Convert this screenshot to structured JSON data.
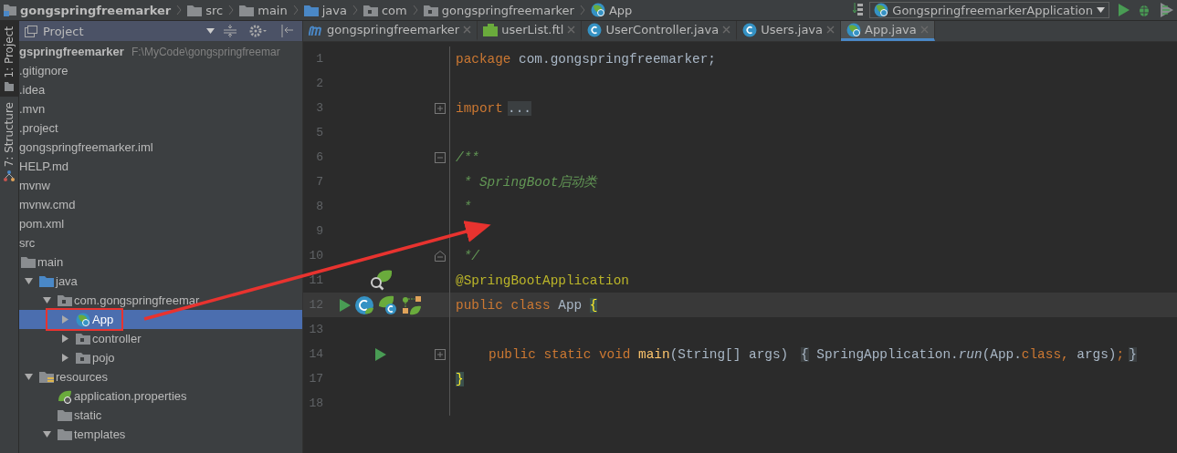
{
  "breadcrumbs": [
    {
      "label": "gongspringfreemarker",
      "kind": "project"
    },
    {
      "label": "src",
      "kind": "folder"
    },
    {
      "label": "main",
      "kind": "folder"
    },
    {
      "label": "java",
      "kind": "source"
    },
    {
      "label": "com",
      "kind": "package"
    },
    {
      "label": "gongspringfreemarker",
      "kind": "package"
    },
    {
      "label": "App",
      "kind": "app"
    }
  ],
  "run_config": {
    "label": "GongspringfreemarkerApplication"
  },
  "side_tabs": [
    {
      "label": "1: Project",
      "selected": true
    },
    {
      "label": "7: Structure",
      "selected": false
    }
  ],
  "project_panel": {
    "title": "Project",
    "tree": [
      {
        "label": "gspringfreemarker",
        "path": "F:\\MyCode\\gongspringfreemar",
        "selected": false,
        "children": [
          {
            "label": ".gitignore",
            "selected": false
          },
          {
            "label": ".idea",
            "selected": false
          },
          {
            "label": ".mvn",
            "selected": false
          },
          {
            "label": ".project",
            "selected": false
          },
          {
            "label": "gongspringfreemarker.iml",
            "selected": false
          },
          {
            "label": "HELP.md",
            "selected": false
          },
          {
            "label": "mvnw",
            "selected": false
          },
          {
            "label": "mvnw.cmd",
            "selected": false
          },
          {
            "label": "pom.xml",
            "selected": false
          },
          {
            "label": "src",
            "selected": false,
            "children": [
              {
                "label": "main",
                "kind": "folder",
                "selected": false,
                "children": [
                  {
                    "label": "java",
                    "kind": "source",
                    "expanded": true,
                    "selected": false,
                    "children": [
                      {
                        "label": "com.gongspringfreemar",
                        "kind": "package",
                        "expanded": true,
                        "selected": false,
                        "children": [
                          {
                            "label": "App",
                            "kind": "app",
                            "expanded": false,
                            "selected": true
                          },
                          {
                            "label": "controller",
                            "kind": "package",
                            "expanded": false,
                            "selected": false
                          },
                          {
                            "label": "pojo",
                            "kind": "package",
                            "expanded": false,
                            "selected": false
                          }
                        ]
                      }
                    ]
                  },
                  {
                    "label": "resources",
                    "kind": "resources",
                    "expanded": true,
                    "selected": false,
                    "children": [
                      {
                        "label": "application.properties",
                        "kind": "properties",
                        "selected": false
                      },
                      {
                        "label": "static",
                        "kind": "folder",
                        "selected": false
                      },
                      {
                        "label": "templates",
                        "kind": "folder",
                        "expanded": true,
                        "selected": false
                      }
                    ]
                  }
                ]
              }
            ]
          }
        ]
      }
    ]
  },
  "editor_tabs": [
    {
      "label": "gongspringfreemarker",
      "kind": "maven",
      "selected": false
    },
    {
      "label": "userList.ftl",
      "kind": "ftl",
      "selected": false
    },
    {
      "label": "UserController.java",
      "kind": "class",
      "selected": false
    },
    {
      "label": "Users.java",
      "kind": "class",
      "selected": false
    },
    {
      "label": "App.java",
      "kind": "app",
      "selected": true
    }
  ],
  "code_lines": [
    {
      "number": "1",
      "tokens": [
        {
          "kind": "keyword",
          "text": "package"
        },
        {
          "kind": "plain",
          "text": " com.gongspringfreemarker;"
        }
      ]
    },
    {
      "number": "2"
    },
    {
      "number": "3",
      "fold_marker": {
        "kind": "plus"
      },
      "tokens": [
        {
          "kind": "keyword",
          "text": "import"
        },
        {
          "kind": "folded",
          "text": "..."
        }
      ]
    },
    {
      "number": "5"
    },
    {
      "number": "6",
      "fold_marker": {
        "kind": "minus"
      },
      "tokens": [
        {
          "kind": "doc",
          "text": "/**"
        }
      ]
    },
    {
      "number": "7",
      "tokens": [
        {
          "kind": "doc",
          "text": " * SpringBoot启动类"
        }
      ]
    },
    {
      "number": "8",
      "tokens": [
        {
          "kind": "doc",
          "text": " *"
        }
      ]
    },
    {
      "number": "9"
    },
    {
      "number": "10",
      "fold_marker": {
        "kind": "end"
      },
      "tokens": [
        {
          "kind": "doc",
          "text": " */"
        }
      ]
    },
    {
      "number": "11",
      "gutter": [
        {
          "kind": "bean-search"
        }
      ],
      "tokens": [
        {
          "kind": "annotation",
          "text": "@SpringBootApplication"
        }
      ]
    },
    {
      "number": "12",
      "current": true,
      "gutter": [
        {
          "kind": "run"
        },
        {
          "kind": "class"
        },
        {
          "kind": "spring-class"
        },
        {
          "kind": "beans"
        }
      ],
      "tokens": [
        {
          "kind": "keyword",
          "text": "public class "
        },
        {
          "kind": "plain",
          "text": "App "
        },
        {
          "kind": "brace",
          "text": "{"
        }
      ]
    },
    {
      "number": "13"
    },
    {
      "number": "14",
      "fold_marker": {
        "kind": "plus"
      },
      "indent": true,
      "gutter": [
        {
          "kind": "run"
        }
      ],
      "tokens": [
        {
          "kind": "keyword",
          "text": "public static void "
        },
        {
          "kind": "method",
          "text": "main"
        },
        {
          "kind": "plain",
          "text": "(String[] args) "
        },
        {
          "kind": "folded",
          "text": "{"
        },
        {
          "kind": "plain",
          "text": " SpringApplication."
        },
        {
          "kind": "italic",
          "text": "run"
        },
        {
          "kind": "plain",
          "text": "(App."
        },
        {
          "kind": "keyword",
          "text": "class,"
        },
        {
          "kind": "plain",
          "text": " args)"
        },
        {
          "kind": "keyword",
          "text": ";"
        },
        {
          "kind": "folded",
          "text": "}"
        }
      ]
    },
    {
      "number": "17",
      "tokens": [
        {
          "kind": "brace",
          "text": "}"
        }
      ]
    },
    {
      "number": "18"
    }
  ]
}
